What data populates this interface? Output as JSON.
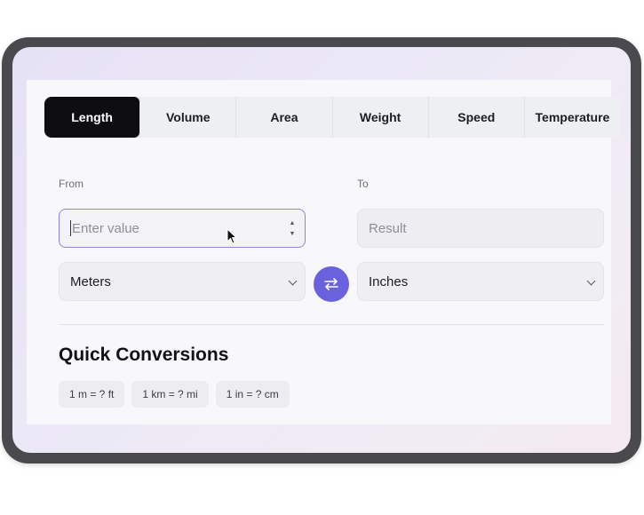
{
  "tabs": [
    "Length",
    "Volume",
    "Area",
    "Weight",
    "Speed",
    "Temperature"
  ],
  "active_tab": "Length",
  "from": {
    "label": "From",
    "placeholder": "Enter value",
    "unit": "Meters"
  },
  "to": {
    "label": "To",
    "placeholder": "Result",
    "unit": "Inches"
  },
  "swap_icon": "swap-arrows-icon",
  "quick": {
    "title": "Quick Conversions",
    "items": [
      "1 m = ? ft",
      "1 km = ? mi",
      "1 in = ? cm"
    ]
  },
  "colors": {
    "accent": "#6a61dd",
    "active_tab_bg": "#0d0d12"
  }
}
